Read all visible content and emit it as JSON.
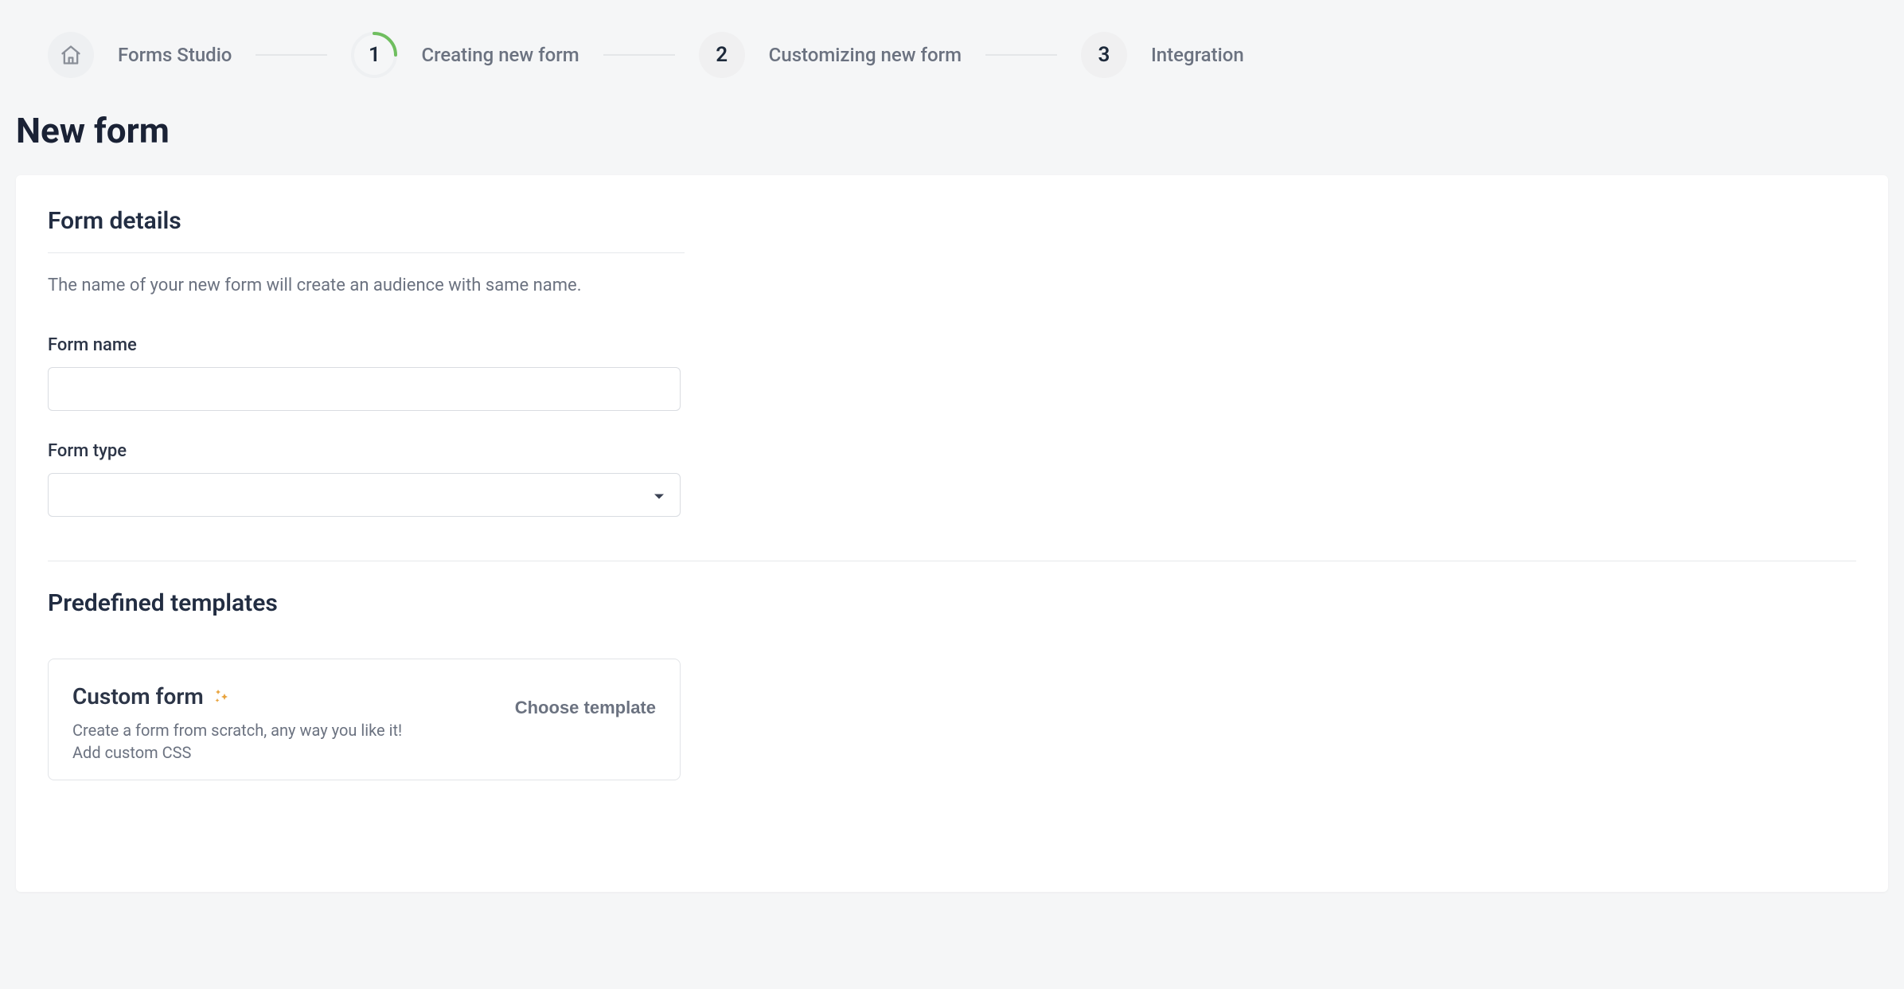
{
  "stepper": {
    "home_label": "Forms Studio",
    "steps": [
      {
        "num": "1",
        "label": "Creating new form",
        "active": true
      },
      {
        "num": "2",
        "label": "Customizing new form",
        "active": false
      },
      {
        "num": "3",
        "label": "Integration",
        "active": false
      }
    ]
  },
  "page": {
    "title": "New form"
  },
  "form_details": {
    "heading": "Form details",
    "description": "The name of your new form will create an audience with same name.",
    "name_label": "Form name",
    "name_value": "",
    "type_label": "Form type",
    "type_value": ""
  },
  "templates": {
    "heading": "Predefined templates",
    "custom": {
      "title": "Custom form",
      "description": "Create a form from scratch, any way you like it! Add custom CSS",
      "action": "Choose template"
    }
  }
}
